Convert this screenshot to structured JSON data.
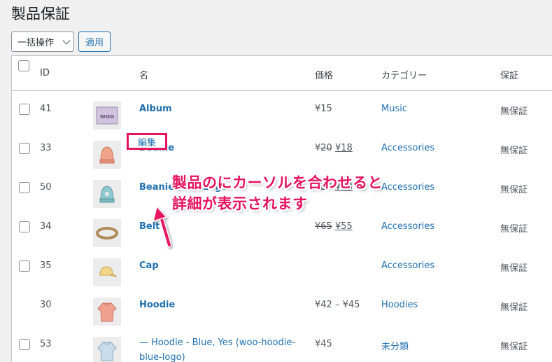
{
  "page": {
    "title": "製品保証"
  },
  "bulk": {
    "selected": "一括操作",
    "apply_label": "適用"
  },
  "table": {
    "headers": {
      "id": "ID",
      "name": "名",
      "price": "価格",
      "category": "カテゴリー",
      "warranty": "保証"
    },
    "rows": [
      {
        "id": "41",
        "name": "Album",
        "price_text": "¥15",
        "category": "Music",
        "warranty": "無保証",
        "thumb": "album-thumbnail",
        "checkbox": true
      },
      {
        "id": "33",
        "name": "Beanie",
        "price_old": "¥20",
        "price_new": "¥18",
        "category": "Accessories",
        "warranty": "無保証",
        "thumb": "beanie-thumbnail",
        "checkbox": true
      },
      {
        "id": "50",
        "name": "Beanie with Logo",
        "price_old": "¥20",
        "price_new": "¥18",
        "category": "Accessories",
        "warranty": "無保証",
        "thumb": "beanie-logo-thumbnail",
        "checkbox": true,
        "row_action": "編集"
      },
      {
        "id": "34",
        "name": "Belt",
        "price_old": "¥65",
        "price_new": "¥55",
        "category": "Accessories",
        "warranty": "無保証",
        "thumb": "belt-thumbnail",
        "checkbox": true
      },
      {
        "id": "35",
        "name": "Cap",
        "price_text": "",
        "category": "Accessories",
        "warranty": "無保証",
        "thumb": "cap-thumbnail",
        "checkbox": true
      },
      {
        "id": "30",
        "name": "Hoodie",
        "price_text": "¥42 – ¥45",
        "category": "Hoodies",
        "warranty": "無保証",
        "thumb": "hoodie-thumbnail",
        "checkbox": false
      },
      {
        "id": "53",
        "name": "— Hoodie - Blue, Yes (woo-hoodie-blue-logo)",
        "price_text": "¥45",
        "category": "未分類",
        "warranty": "無保証",
        "thumb": "hoodie-blue-thumbnail",
        "checkbox": true
      }
    ]
  },
  "annotation": {
    "line1": "製品のにカーソルを合わせると",
    "line2": "詳細が表示されます"
  },
  "colors": {
    "link": "#2271b1",
    "annotation": "#e6145e",
    "border": "#c3c4c7"
  }
}
